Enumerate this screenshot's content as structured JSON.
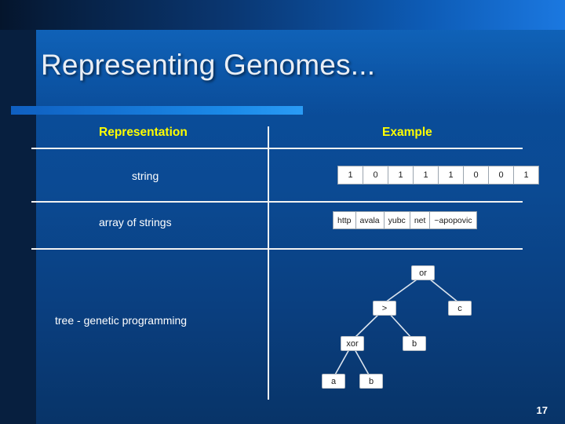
{
  "slide": {
    "title": "Representing Genomes...",
    "page_number": "17"
  },
  "table": {
    "headers": {
      "representation": "Representation",
      "example": "Example"
    },
    "rows": [
      {
        "label": "string"
      },
      {
        "label": "array of strings"
      },
      {
        "label": "tree - genetic programming"
      }
    ]
  },
  "string_example": {
    "bits": [
      "1",
      "0",
      "1",
      "1",
      "1",
      "0",
      "0",
      "1"
    ]
  },
  "array_example": {
    "items": [
      "http",
      "avala",
      "yubc",
      "net",
      "~apopovic"
    ]
  },
  "tree_example": {
    "nodes": [
      {
        "label": "or"
      },
      {
        "label": ">"
      },
      {
        "label": "c"
      },
      {
        "label": "xor"
      },
      {
        "label": "b"
      },
      {
        "label": "a"
      },
      {
        "label": "b"
      }
    ]
  },
  "colors": {
    "header_yellow": "#ffff00",
    "rule_blue": "#1b8ae8",
    "background_blue": "#0a4d9b"
  }
}
